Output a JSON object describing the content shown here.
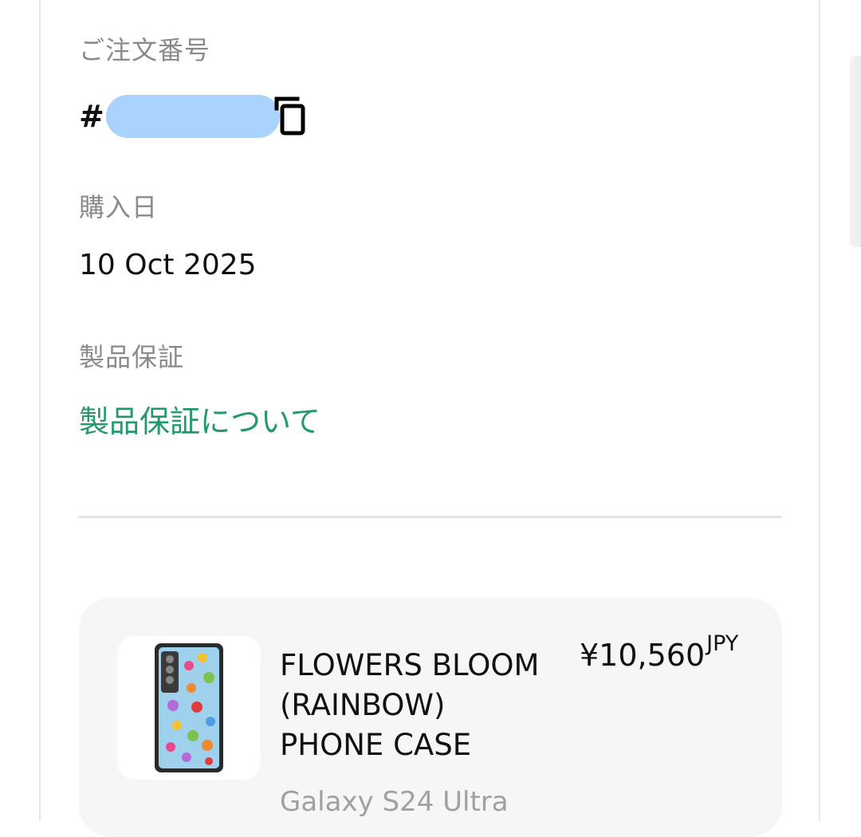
{
  "order": {
    "label": "ご注文番号",
    "hash": "#"
  },
  "purchase": {
    "label": "購入日",
    "date": "10 Oct 2025"
  },
  "warranty": {
    "label": "製品保証",
    "link": "製品保証について"
  },
  "product": {
    "name": "FLOWERS BLOOM\n(RAINBOW)\nPHONE CASE",
    "price": "¥10,560",
    "currency": "JPY",
    "variant": "Galaxy S24 Ultra"
  },
  "colors": {
    "link": "#23996b",
    "redaction": "#a9d2fc",
    "card_bg": "#f6f6f6"
  }
}
